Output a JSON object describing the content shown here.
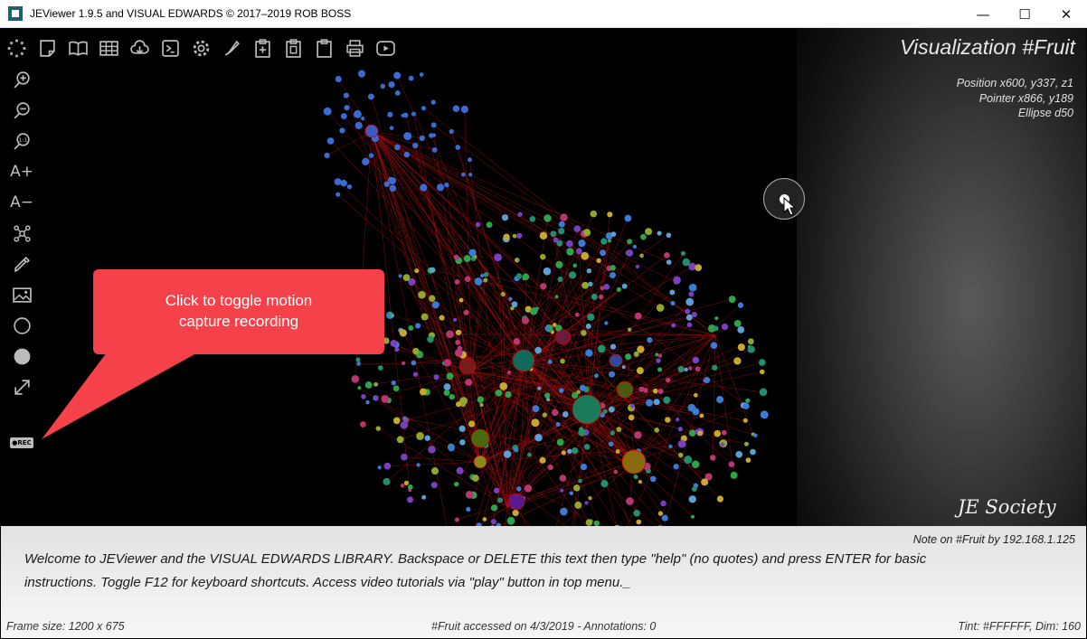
{
  "window": {
    "title": "JEViewer 1.9.5 and VISUAL EDWARDS © 2017–2019 ROB BOSS",
    "minimize": "—",
    "maximize": "☐",
    "close": "✕"
  },
  "toolbar_top": [
    {
      "icon": "loading-dots-icon"
    },
    {
      "icon": "note-icon"
    },
    {
      "icon": "book-icon"
    },
    {
      "icon": "grid-icon"
    },
    {
      "icon": "cloud-download-icon"
    },
    {
      "icon": "terminal-icon"
    },
    {
      "icon": "gear-icon"
    },
    {
      "icon": "pen-icon"
    },
    {
      "icon": "clipboard-add-icon"
    },
    {
      "icon": "clipboard-copy-icon"
    },
    {
      "icon": "clipboard-icon"
    },
    {
      "icon": "printer-icon"
    },
    {
      "icon": "play-icon"
    }
  ],
  "toolbar_left": [
    {
      "icon": "zoom-in-icon"
    },
    {
      "icon": "zoom-out-icon"
    },
    {
      "icon": "zoom-reset-icon"
    },
    {
      "icon": "font-increase-icon",
      "label": "A+"
    },
    {
      "icon": "font-decrease-icon",
      "label": "A−"
    },
    {
      "icon": "network-icon"
    },
    {
      "icon": "eyedropper-icon"
    },
    {
      "icon": "image-icon"
    },
    {
      "icon": "circle-outline-icon"
    },
    {
      "icon": "circle-filled-icon"
    },
    {
      "icon": "expand-icon"
    },
    {
      "icon": "rec-icon",
      "label": "●REC"
    }
  ],
  "viz": {
    "title": "Visualization #Fruit",
    "position": "Position x600, y337, z1",
    "pointer": "Pointer x866, y189",
    "ellipse": "Ellipse d50"
  },
  "callout": {
    "line1": "Click to toggle motion",
    "line2": "capture recording",
    "color": "#f5424a"
  },
  "logo": "JE Society",
  "note": {
    "by": "Note on #Fruit by 192.168.1.125",
    "text": "Welcome to JEViewer and the VISUAL EDWARDS LIBRARY. Backspace or DELETE this text then type \"help\" (no quotes) and press ENTER for basic instructions. Toggle F12 for keyboard shortcuts. Access video tutorials via \"play\" button in top menu._"
  },
  "status": {
    "frame": "Frame size: 1200 x 675",
    "accessed": "#Fruit accessed on 4/3/2019 - Annotations: 0",
    "tint": "Tint: #FFFFFF, Dim: 160"
  },
  "colors": {
    "edge": "#b01010",
    "accent_green": "#1a7a5a"
  }
}
